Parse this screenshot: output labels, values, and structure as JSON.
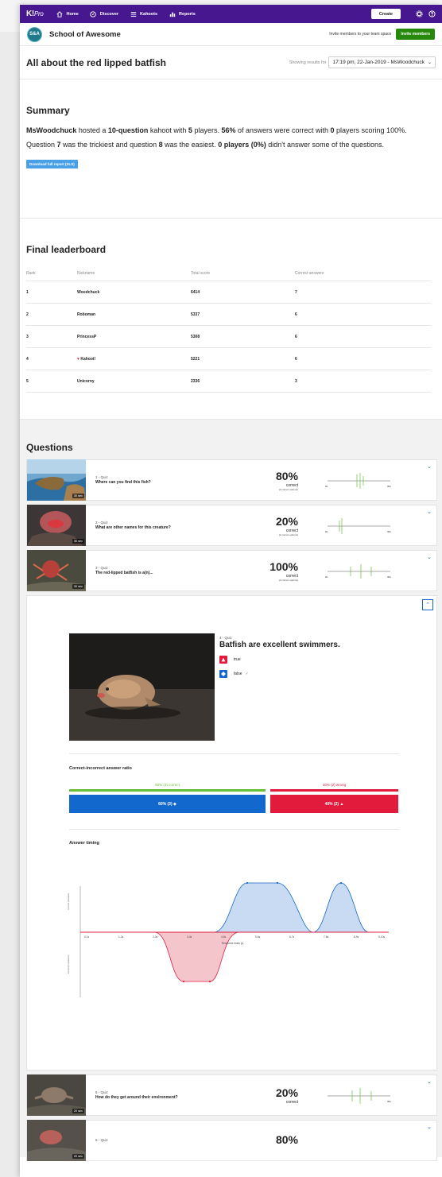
{
  "nav": {
    "logo": "K!",
    "logo_suffix": "Pro",
    "items": [
      {
        "label": "Home",
        "icon": "home-icon"
      },
      {
        "label": "Discover",
        "icon": "compass-icon"
      },
      {
        "label": "Kahoots",
        "icon": "list-icon"
      },
      {
        "label": "Reports",
        "icon": "bar-chart-icon"
      }
    ],
    "create_label": "Create"
  },
  "team": {
    "avatar_initials": "S&A",
    "name": "School of Awesome",
    "invite_text": "Invite members to your team space",
    "invite_button": "Invite members"
  },
  "report": {
    "title": "All about the red lipped batfish",
    "results_label": "Showing results for",
    "session": "17:19 pm, 22-Jan-2019 - MsWoodchuck"
  },
  "summary": {
    "title": "Summary",
    "host": "MsWoodchuck",
    "t1": " hosted a ",
    "questions": "10-question",
    "t2": " kahoot with ",
    "players": "5",
    "t3": " players. ",
    "pct_correct": "56%",
    "t4": " of answers were correct with ",
    "perfect": "0",
    "t5": " players scoring 100%. Question ",
    "trickiest": "7",
    "t6": " was the trickiest and question ",
    "easiest": "8",
    "t7": " was the easiest. ",
    "unanswered": "0 players (0%)",
    "t8": " didn't answer some of the questions.",
    "download_label": "Download full report (XLS)"
  },
  "leaderboard": {
    "title": "Final leaderboard",
    "headers": [
      "Rank",
      "Nickname",
      "Total score",
      "Correct answers"
    ],
    "rows": [
      {
        "rank": "1",
        "nickname": "Woodchuck",
        "score": "6414",
        "correct": "7"
      },
      {
        "rank": "2",
        "nickname": "Roboman",
        "score": "5337",
        "correct": "6"
      },
      {
        "rank": "3",
        "nickname": "PrincessP",
        "score": "5308",
        "correct": "6"
      },
      {
        "rank": "4",
        "nickname": "Kahoot!",
        "score": "5221",
        "correct": "6"
      },
      {
        "rank": "5",
        "nickname": "Unicorny",
        "score": "2336",
        "correct": "3"
      }
    ]
  },
  "questions": {
    "title": "Questions",
    "correct_label": "correct",
    "options_note": "(2 correct options)",
    "axis_start": "0s",
    "axis_end": "30s",
    "list_top": [
      {
        "label": "1 - Quiz",
        "text": "Where can you find this fish?",
        "pct": "80%",
        "time": "30 sec"
      },
      {
        "label": "2 - Quiz",
        "text": "What are other names for this creature?",
        "pct": "20%",
        "time": "30 sec"
      },
      {
        "label": "3 - Quiz",
        "text": "The red-lipped batfish is a(n)...",
        "pct": "100%",
        "time": "30 sec"
      }
    ],
    "expanded": {
      "label": "4 - Quiz",
      "text": "Batfish are excellent swimmers.",
      "answers": [
        {
          "text": "true",
          "color": "#e21b3c",
          "shape": "triangle"
        },
        {
          "text": "false",
          "color": "#1368ce",
          "shape": "diamond",
          "correct": "✓"
        }
      ],
      "ratio_title": "Correct-incorrect answer ratio",
      "correct_top": "60% (3) correct",
      "wrong_top": "40% (2) wrong",
      "correct_bar": "60% (3) ◆",
      "wrong_bar": "40% (2) ▲",
      "timing_title": "Answer timing",
      "y_upper": "correct answers",
      "y_lower": "incorrect answers",
      "x_ticks": [
        "0-1s",
        "1-2s",
        "2-3s",
        "3-4s",
        "4-5s",
        "5-6s",
        "6-7s",
        "7-8s",
        "8-9s",
        "9-10s"
      ],
      "x_title": "Response times (s)"
    },
    "list_bottom": [
      {
        "label": "5 - Quiz",
        "text": "How do they get around their environment?",
        "pct": "20%",
        "time": "20 sec"
      },
      {
        "label": "6 - Quiz",
        "text": "",
        "pct": "80%",
        "time": "20 sec"
      }
    ]
  },
  "colors": {
    "nav": "#46178f",
    "invite": "#26890c",
    "correct": "#1368ce",
    "wrong": "#e21b3c",
    "correct_line": "#66bf39"
  }
}
